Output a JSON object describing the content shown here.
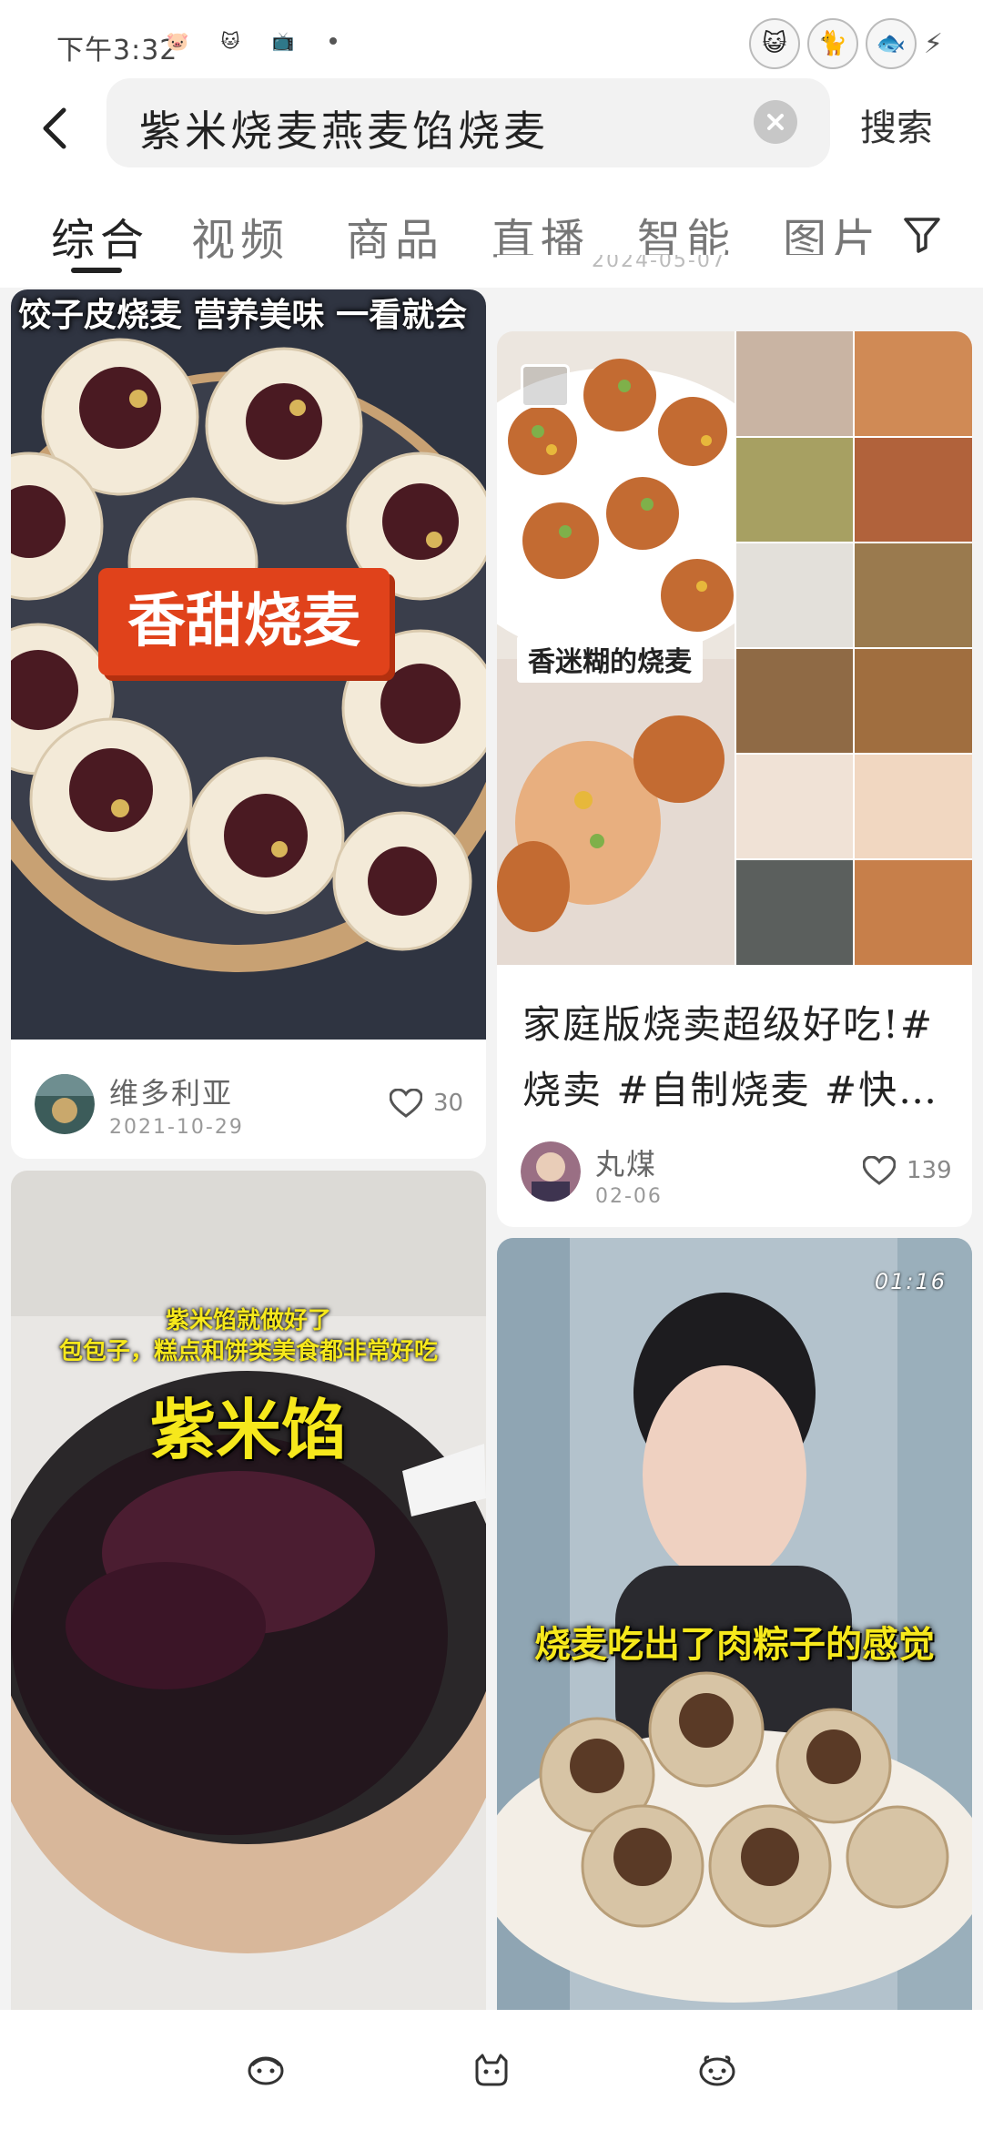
{
  "status_bar": {
    "time": "下午3:32"
  },
  "search": {
    "query": "紫米烧麦燕麦馅烧麦",
    "button_label": "搜索"
  },
  "tabs": [
    {
      "label": "综合",
      "active": true
    },
    {
      "label": "视频",
      "active": false
    },
    {
      "label": "商品",
      "active": false
    },
    {
      "label": "直播",
      "active": false
    },
    {
      "label": "智能",
      "active": false
    },
    {
      "label": "图片",
      "active": false
    }
  ],
  "feed": {
    "cards": [
      {
        "overlay_title": "饺子皮烧麦 营养美味 一看就会",
        "overlay_badge": "香甜烧麦",
        "author": "维多利亚",
        "date": "2021-10-29",
        "likes": "30"
      },
      {
        "top_partial_date": "2024-05-07",
        "overlay_label": "香迷糊的烧麦",
        "title": "家庭版烧卖超级好吃!# 烧卖 #自制烧麦 #快…",
        "author": "丸煤",
        "date": "02-06",
        "likes": "139"
      },
      {
        "overlay_line1": "紫米馅就做好了",
        "overlay_line2": "包包子，糕点和饼类美食都非常好吃",
        "overlay_big": "紫米馅"
      },
      {
        "duration": "01:16",
        "overlay_caption": "烧麦吃出了肉粽子的感觉"
      }
    ]
  },
  "colors": {
    "accent_red": "#e0421b",
    "caption_yellow": "#f6e81c",
    "bg": "#f3f3f3"
  },
  "icons": [
    "back-arrow-icon",
    "clear-icon",
    "filter-icon",
    "heart-icon",
    "image-icon",
    "nav-home-icon",
    "nav-cat-icon",
    "nav-face-icon"
  ]
}
